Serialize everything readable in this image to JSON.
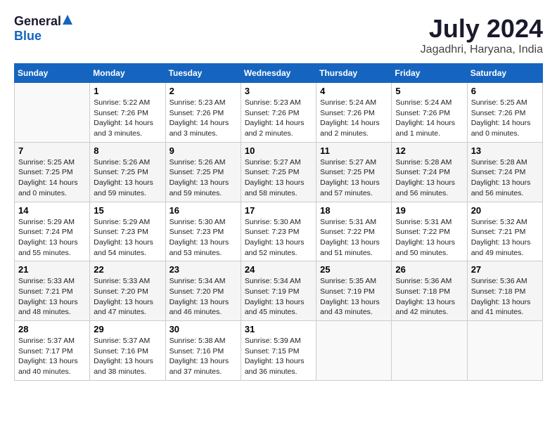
{
  "header": {
    "logo_general": "General",
    "logo_blue": "Blue",
    "month": "July 2024",
    "location": "Jagadhri, Haryana, India"
  },
  "days_of_week": [
    "Sunday",
    "Monday",
    "Tuesday",
    "Wednesday",
    "Thursday",
    "Friday",
    "Saturday"
  ],
  "weeks": [
    [
      {
        "day": "",
        "info": ""
      },
      {
        "day": "1",
        "info": "Sunrise: 5:22 AM\nSunset: 7:26 PM\nDaylight: 14 hours\nand 3 minutes."
      },
      {
        "day": "2",
        "info": "Sunrise: 5:23 AM\nSunset: 7:26 PM\nDaylight: 14 hours\nand 3 minutes."
      },
      {
        "day": "3",
        "info": "Sunrise: 5:23 AM\nSunset: 7:26 PM\nDaylight: 14 hours\nand 2 minutes."
      },
      {
        "day": "4",
        "info": "Sunrise: 5:24 AM\nSunset: 7:26 PM\nDaylight: 14 hours\nand 2 minutes."
      },
      {
        "day": "5",
        "info": "Sunrise: 5:24 AM\nSunset: 7:26 PM\nDaylight: 14 hours\nand 1 minute."
      },
      {
        "day": "6",
        "info": "Sunrise: 5:25 AM\nSunset: 7:26 PM\nDaylight: 14 hours\nand 0 minutes."
      }
    ],
    [
      {
        "day": "7",
        "info": "Sunrise: 5:25 AM\nSunset: 7:25 PM\nDaylight: 14 hours\nand 0 minutes."
      },
      {
        "day": "8",
        "info": "Sunrise: 5:26 AM\nSunset: 7:25 PM\nDaylight: 13 hours\nand 59 minutes."
      },
      {
        "day": "9",
        "info": "Sunrise: 5:26 AM\nSunset: 7:25 PM\nDaylight: 13 hours\nand 59 minutes."
      },
      {
        "day": "10",
        "info": "Sunrise: 5:27 AM\nSunset: 7:25 PM\nDaylight: 13 hours\nand 58 minutes."
      },
      {
        "day": "11",
        "info": "Sunrise: 5:27 AM\nSunset: 7:25 PM\nDaylight: 13 hours\nand 57 minutes."
      },
      {
        "day": "12",
        "info": "Sunrise: 5:28 AM\nSunset: 7:24 PM\nDaylight: 13 hours\nand 56 minutes."
      },
      {
        "day": "13",
        "info": "Sunrise: 5:28 AM\nSunset: 7:24 PM\nDaylight: 13 hours\nand 56 minutes."
      }
    ],
    [
      {
        "day": "14",
        "info": "Sunrise: 5:29 AM\nSunset: 7:24 PM\nDaylight: 13 hours\nand 55 minutes."
      },
      {
        "day": "15",
        "info": "Sunrise: 5:29 AM\nSunset: 7:23 PM\nDaylight: 13 hours\nand 54 minutes."
      },
      {
        "day": "16",
        "info": "Sunrise: 5:30 AM\nSunset: 7:23 PM\nDaylight: 13 hours\nand 53 minutes."
      },
      {
        "day": "17",
        "info": "Sunrise: 5:30 AM\nSunset: 7:23 PM\nDaylight: 13 hours\nand 52 minutes."
      },
      {
        "day": "18",
        "info": "Sunrise: 5:31 AM\nSunset: 7:22 PM\nDaylight: 13 hours\nand 51 minutes."
      },
      {
        "day": "19",
        "info": "Sunrise: 5:31 AM\nSunset: 7:22 PM\nDaylight: 13 hours\nand 50 minutes."
      },
      {
        "day": "20",
        "info": "Sunrise: 5:32 AM\nSunset: 7:21 PM\nDaylight: 13 hours\nand 49 minutes."
      }
    ],
    [
      {
        "day": "21",
        "info": "Sunrise: 5:33 AM\nSunset: 7:21 PM\nDaylight: 13 hours\nand 48 minutes."
      },
      {
        "day": "22",
        "info": "Sunrise: 5:33 AM\nSunset: 7:20 PM\nDaylight: 13 hours\nand 47 minutes."
      },
      {
        "day": "23",
        "info": "Sunrise: 5:34 AM\nSunset: 7:20 PM\nDaylight: 13 hours\nand 46 minutes."
      },
      {
        "day": "24",
        "info": "Sunrise: 5:34 AM\nSunset: 7:19 PM\nDaylight: 13 hours\nand 45 minutes."
      },
      {
        "day": "25",
        "info": "Sunrise: 5:35 AM\nSunset: 7:19 PM\nDaylight: 13 hours\nand 43 minutes."
      },
      {
        "day": "26",
        "info": "Sunrise: 5:36 AM\nSunset: 7:18 PM\nDaylight: 13 hours\nand 42 minutes."
      },
      {
        "day": "27",
        "info": "Sunrise: 5:36 AM\nSunset: 7:18 PM\nDaylight: 13 hours\nand 41 minutes."
      }
    ],
    [
      {
        "day": "28",
        "info": "Sunrise: 5:37 AM\nSunset: 7:17 PM\nDaylight: 13 hours\nand 40 minutes."
      },
      {
        "day": "29",
        "info": "Sunrise: 5:37 AM\nSunset: 7:16 PM\nDaylight: 13 hours\nand 38 minutes."
      },
      {
        "day": "30",
        "info": "Sunrise: 5:38 AM\nSunset: 7:16 PM\nDaylight: 13 hours\nand 37 minutes."
      },
      {
        "day": "31",
        "info": "Sunrise: 5:39 AM\nSunset: 7:15 PM\nDaylight: 13 hours\nand 36 minutes."
      },
      {
        "day": "",
        "info": ""
      },
      {
        "day": "",
        "info": ""
      },
      {
        "day": "",
        "info": ""
      }
    ]
  ]
}
